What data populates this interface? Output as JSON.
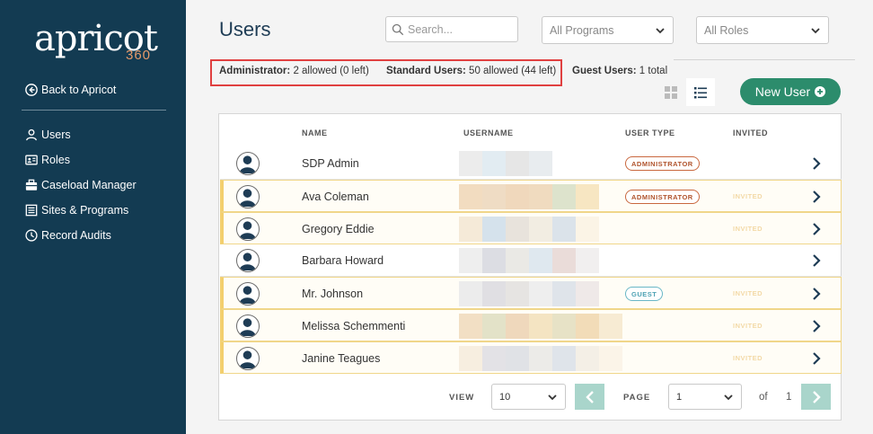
{
  "sidebar": {
    "logo": "apricot",
    "logo_sub": "360",
    "back_label": "Back to Apricot",
    "items": [
      {
        "label": "Users",
        "icon": "user-icon"
      },
      {
        "label": "Roles",
        "icon": "id-card-icon"
      },
      {
        "label": "Caseload Manager",
        "icon": "briefcase-icon"
      },
      {
        "label": "Sites & Programs",
        "icon": "list-icon"
      },
      {
        "label": "Record Audits",
        "icon": "clock-icon"
      }
    ]
  },
  "header": {
    "title": "Users",
    "search_placeholder": "Search...",
    "programs_filter": "All Programs",
    "roles_filter": "All Roles",
    "new_user_label": "New User"
  },
  "summary": {
    "admin_label": "Administrator:",
    "admin_value": "2 allowed (0 left)",
    "standard_label": "Standard Users:",
    "standard_value": "50 allowed (44 left)",
    "guest_label": "Guest Users:",
    "guest_value": "1 total"
  },
  "table": {
    "columns": [
      "NAME",
      "USERNAME",
      "USER TYPE",
      "INVITED"
    ],
    "rows": [
      {
        "name": "SDP Admin",
        "badge": "ADMINISTRATOR",
        "badge_type": "admin",
        "invited": ""
      },
      {
        "name": "Ava Coleman",
        "badge": "ADMINISTRATOR",
        "badge_type": "admin",
        "invited": "INVITED"
      },
      {
        "name": "Gregory Eddie",
        "badge": "",
        "badge_type": "",
        "invited": "INVITED"
      },
      {
        "name": "Barbara Howard",
        "badge": "",
        "badge_type": "",
        "invited": ""
      },
      {
        "name": "Mr. Johnson",
        "badge": "GUEST",
        "badge_type": "guest",
        "invited": "INVITED"
      },
      {
        "name": "Melissa Schemmenti",
        "badge": "",
        "badge_type": "",
        "invited": "INVITED"
      },
      {
        "name": "Janine Teagues",
        "badge": "",
        "badge_type": "",
        "invited": "INVITED"
      }
    ]
  },
  "pager": {
    "view_label": "VIEW",
    "view_value": "10",
    "page_label": "PAGE",
    "page_value": "1",
    "of_label": "of",
    "total_pages": "1"
  },
  "colors": {
    "sidebar": "#133b52",
    "accent": "#2c8c6c",
    "admin_badge": "#c9683f",
    "guest_badge": "#6ab7c6",
    "highlight": "#e04040"
  }
}
